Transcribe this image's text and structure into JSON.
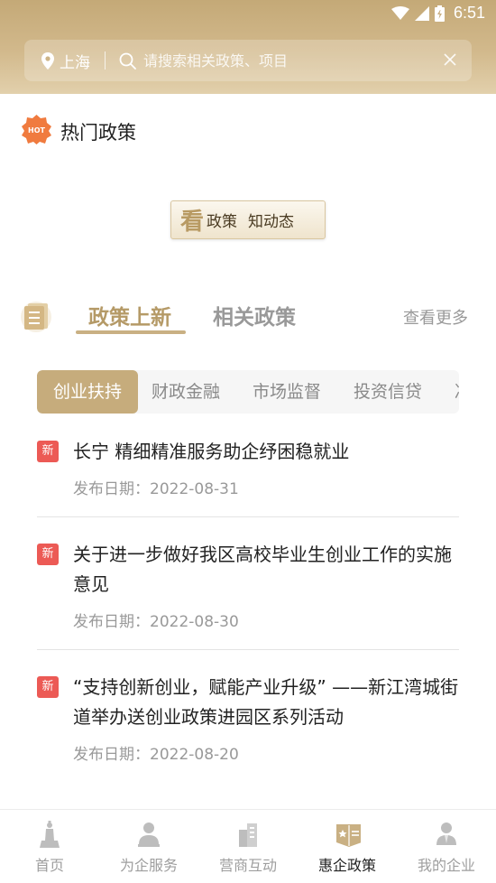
{
  "status": {
    "time": "6:51"
  },
  "search": {
    "city": "上海",
    "placeholder": "请搜索相关政策、项目"
  },
  "hot": {
    "badge": "HOT",
    "title": "热门政策"
  },
  "banner": {
    "big_char": "看",
    "text1": "政策",
    "text2": "知动态"
  },
  "tabs": {
    "active": "政策上新",
    "inactive": "相关政策",
    "more": "查看更多"
  },
  "categories": [
    "创业扶持",
    "财政金融",
    "市场监督",
    "投资信贷",
    "决"
  ],
  "news": [
    {
      "tag": "新",
      "title": "长宁 精细精准服务助企纾困稳就业",
      "date": "发布日期：2022-08-31"
    },
    {
      "tag": "新",
      "title": "关于进一步做好我区高校毕业生创业工作的实施意见",
      "date": "发布日期：2022-08-30"
    },
    {
      "tag": "新",
      "title": "“支持创新创业，赋能产业升级” ——新江湾城街道举办送创业政策进园区系列活动",
      "date": "发布日期：2022-08-20"
    }
  ],
  "tabbar": [
    {
      "label": "首页",
      "icon": "home-icon"
    },
    {
      "label": "为企服务",
      "icon": "service-icon"
    },
    {
      "label": "营商互动",
      "icon": "building-icon"
    },
    {
      "label": "惠企政策",
      "icon": "policy-icon"
    },
    {
      "label": "我的企业",
      "icon": "user-icon"
    }
  ],
  "colors": {
    "header": "#c4a977",
    "accent": "#b59a67",
    "chip_active": "#c6ac7c",
    "new_tag": "#ec5a55"
  }
}
